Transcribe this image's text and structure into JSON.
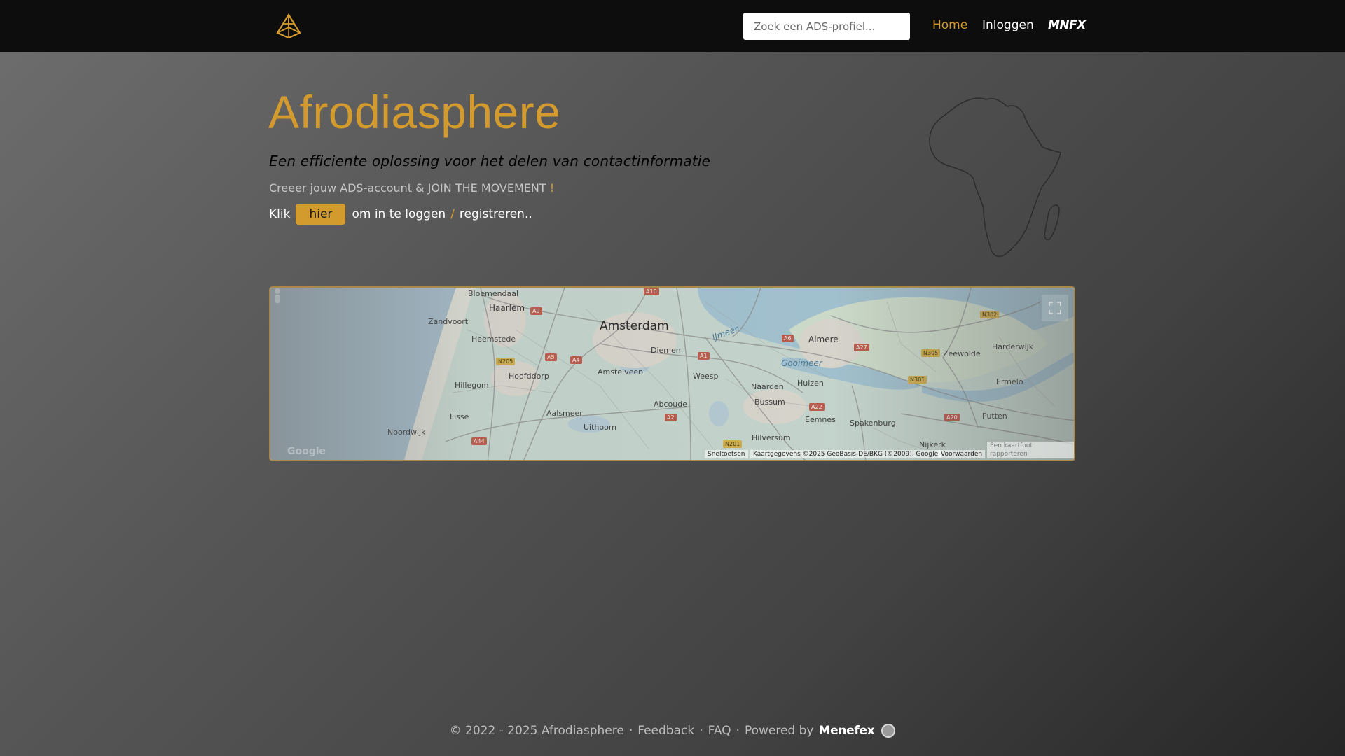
{
  "nav": {
    "search_placeholder": "Zoek een ADS-profiel...",
    "home": "Home",
    "login": "Inloggen",
    "mnfx": "MNFX"
  },
  "hero": {
    "title": "Afrodiasphere",
    "subtitle": "Een efficiente oplossing voor het delen van contactinformatie",
    "line": "Creeer jouw ADS-account & JOIN THE MOVEMENT",
    "line_excl": "!",
    "klik": "Klik",
    "hier": "hier",
    "login_text": "om in te loggen",
    "slash": "/",
    "register_text": "registreren.."
  },
  "map": {
    "cities": {
      "amsterdam": "Amsterdam",
      "bloemendaal": "Bloemendaal",
      "haarlem": "Haarlem",
      "zandvoort": "Zandvoort",
      "heemstede": "Heemstede",
      "hoofddorp": "Hoofddorp",
      "hillegom": "Hillegom",
      "lisse": "Lisse",
      "noordwijk": "Noordwijk",
      "aalsmeer": "Aalsmeer",
      "uithoorn": "Uithoorn",
      "amstelveen": "Amstelveen",
      "diemen": "Diemen",
      "abcoude": "Abcoude",
      "weesp": "Weesp",
      "naarden": "Naarden",
      "bussum": "Bussum",
      "huizen": "Huizen",
      "hilversum": "Hilversum",
      "eemnes": "Eemnes",
      "almere": "Almere",
      "spakenburg": "Spakenburg",
      "zeewolde": "Zeewolde",
      "harderwijk": "Harderwijk",
      "ermelo": "Ermelo",
      "putten": "Putten",
      "nijkerk": "Nijkerk"
    },
    "water": {
      "gooimeer": "Gooimeer",
      "ijmeer": "IJmeer"
    },
    "roads": [
      "A10",
      "A9",
      "A5",
      "A4",
      "A1",
      "A6",
      "A27",
      "A2",
      "A22",
      "A44",
      "A20",
      "N205",
      "N201",
      "N301",
      "N305",
      "N302"
    ],
    "attribution": {
      "shortcuts": "Sneltoetsen",
      "data": "Kaartgegevens ©2025 GeoBasis-DE/BKG (©2009), Google",
      "terms": "Voorwaarden",
      "report": "Een kaartfout rapporteren"
    },
    "google": "Google"
  },
  "footer": {
    "copyright": "© 2022 - 2025 Afrodiasphere",
    "feedback": "Feedback",
    "faq": "FAQ",
    "powered": "Powered by",
    "brand": "Menefex",
    "sep": "·"
  },
  "colors": {
    "accent": "#d39b2e",
    "navbar": "#0d0d0d"
  }
}
